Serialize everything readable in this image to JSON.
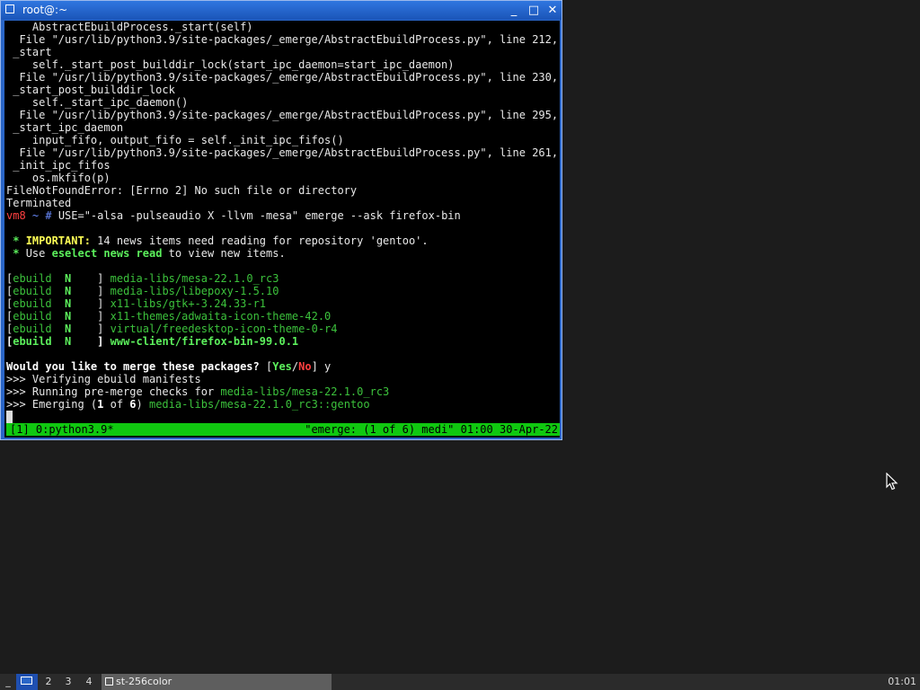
{
  "window": {
    "title": "root@:~",
    "buttons": {
      "minimize": "_",
      "maximize": "□",
      "close": "✕"
    }
  },
  "terminal": {
    "lines": [
      [
        [
          "    AbstractEbuildProcess._start(self)",
          ""
        ]
      ],
      [
        [
          "  File \"/usr/lib/python3.9/site-packages/_emerge/AbstractEbuildProcess.py\", line 212, in",
          ""
        ]
      ],
      [
        [
          " _start",
          ""
        ]
      ],
      [
        [
          "    self._start_post_builddir_lock(start_ipc_daemon=start_ipc_daemon)",
          ""
        ]
      ],
      [
        [
          "  File \"/usr/lib/python3.9/site-packages/_emerge/AbstractEbuildProcess.py\", line 230, in",
          ""
        ]
      ],
      [
        [
          " _start_post_builddir_lock",
          ""
        ]
      ],
      [
        [
          "    self._start_ipc_daemon()",
          ""
        ]
      ],
      [
        [
          "  File \"/usr/lib/python3.9/site-packages/_emerge/AbstractEbuildProcess.py\", line 295, in",
          ""
        ]
      ],
      [
        [
          " _start_ipc_daemon",
          ""
        ]
      ],
      [
        [
          "    input_fifo, output_fifo = self._init_ipc_fifos()",
          ""
        ]
      ],
      [
        [
          "  File \"/usr/lib/python3.9/site-packages/_emerge/AbstractEbuildProcess.py\", line 261, in",
          ""
        ]
      ],
      [
        [
          " _init_ipc_fifos",
          ""
        ]
      ],
      [
        [
          "    os.mkfifo(p)",
          ""
        ]
      ],
      [
        [
          "FileNotFoundError: [Errno 2] No such file or directory",
          ""
        ]
      ],
      [
        [
          "Terminated",
          ""
        ]
      ],
      [
        [
          "vm8",
          "r"
        ],
        [
          " ~ # ",
          "b"
        ],
        [
          "USE=\"-alsa -pulseaudio X -llvm -mesa\" emerge --ask firefox-bin",
          ""
        ]
      ],
      [
        [
          "",
          ""
        ]
      ],
      [
        [
          " * ",
          "bg"
        ],
        [
          "IMPORTANT:",
          "y"
        ],
        [
          " 14 news items need reading for repository 'gentoo'.",
          ""
        ]
      ],
      [
        [
          " * ",
          "bg"
        ],
        [
          "Use ",
          ""
        ],
        [
          "eselect news read",
          "bg"
        ],
        [
          " to view new items.",
          ""
        ]
      ],
      [
        [
          "",
          ""
        ]
      ],
      [
        [
          "[",
          ""
        ],
        [
          "ebuild",
          "g"
        ],
        [
          "  ",
          ""
        ],
        [
          "N",
          "bg"
        ],
        [
          "    ] ",
          ""
        ],
        [
          "media-libs/mesa-22.1.0_rc3",
          "g"
        ]
      ],
      [
        [
          "[",
          ""
        ],
        [
          "ebuild",
          "g"
        ],
        [
          "  ",
          ""
        ],
        [
          "N",
          "bg"
        ],
        [
          "    ] ",
          ""
        ],
        [
          "media-libs/libepoxy-1.5.10",
          "g"
        ]
      ],
      [
        [
          "[",
          ""
        ],
        [
          "ebuild",
          "g"
        ],
        [
          "  ",
          ""
        ],
        [
          "N",
          "bg"
        ],
        [
          "    ] ",
          ""
        ],
        [
          "x11-libs/gtk+-3.24.33-r1",
          "g"
        ]
      ],
      [
        [
          "[",
          ""
        ],
        [
          "ebuild",
          "g"
        ],
        [
          "  ",
          ""
        ],
        [
          "N",
          "bg"
        ],
        [
          "    ] ",
          ""
        ],
        [
          "x11-themes/adwaita-icon-theme-42.0",
          "g"
        ]
      ],
      [
        [
          "[",
          ""
        ],
        [
          "ebuild",
          "g"
        ],
        [
          "  ",
          ""
        ],
        [
          "N",
          "bg"
        ],
        [
          "    ] ",
          ""
        ],
        [
          "virtual/freedesktop-icon-theme-0-r4",
          "g"
        ]
      ],
      [
        [
          "[",
          "w"
        ],
        [
          "ebuild",
          "bg"
        ],
        [
          "  ",
          ""
        ],
        [
          "N",
          "bg"
        ],
        [
          "    ] ",
          "w"
        ],
        [
          "www-client/firefox-bin-99.0.1",
          "bg"
        ]
      ],
      [
        [
          "",
          ""
        ]
      ],
      [
        [
          "Would you like to merge these packages?",
          "w"
        ],
        [
          " [",
          ""
        ],
        [
          "Yes",
          "bg"
        ],
        [
          "/",
          ""
        ],
        [
          "No",
          "rb"
        ],
        [
          "] y",
          ""
        ]
      ],
      [
        [
          ">>> Verifying ebuild manifests",
          ""
        ]
      ],
      [
        [
          ">>> Running pre-merge checks for ",
          ""
        ],
        [
          "media-libs/mesa-22.1.0_rc3",
          "g"
        ]
      ],
      [
        [
          ">>> Emerging (",
          ""
        ],
        [
          "1",
          "w"
        ],
        [
          " of ",
          ""
        ],
        [
          "6",
          "w"
        ],
        [
          ") ",
          ""
        ],
        [
          "media-libs/mesa-22.1.0_rc3::gentoo",
          "g"
        ]
      ]
    ],
    "status_left": "[1] 0:python3.9*",
    "status_right": "\"emerge: (1 of 6) medi\" 01:00 30-Apr-22"
  },
  "taskbar": {
    "menu": "_",
    "workspaces": [
      "2",
      "3",
      "4"
    ],
    "task_label": "st-256color",
    "clock": "01:01"
  }
}
